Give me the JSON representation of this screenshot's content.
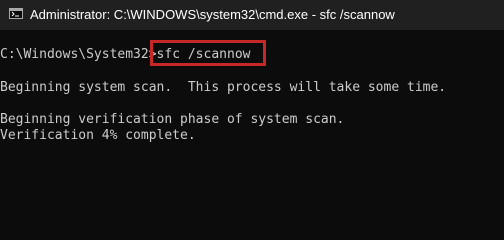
{
  "window": {
    "title": "Administrator: C:\\WINDOWS\\system32\\cmd.exe - sfc  /scannow",
    "icon": "console-icon"
  },
  "console": {
    "prompt": "C:\\Windows\\System32>",
    "command": "sfc /scannow",
    "lines": [
      "Beginning system scan.  This process will take some time.",
      "Beginning verification phase of system scan.",
      "Verification 4% complete."
    ]
  },
  "colors": {
    "background": "#0c0c0c",
    "titlebar": "#202020",
    "text": "#cccccc",
    "highlight_border": "#c62828"
  }
}
